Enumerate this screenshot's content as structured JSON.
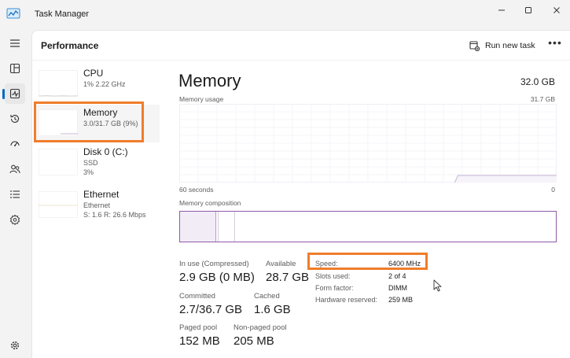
{
  "window": {
    "title": "Task Manager",
    "controls": {
      "minimize": "minimize-icon",
      "maximize": "maximize-icon",
      "close": "close-icon"
    }
  },
  "rail": {
    "items": [
      {
        "id": "menu",
        "icon": "hamburger-icon"
      },
      {
        "id": "processes",
        "icon": "processes-icon"
      },
      {
        "id": "performance",
        "icon": "performance-icon",
        "active": true
      },
      {
        "id": "app-history",
        "icon": "history-icon"
      },
      {
        "id": "startup-apps",
        "icon": "startup-icon"
      },
      {
        "id": "users",
        "icon": "users-icon"
      },
      {
        "id": "details",
        "icon": "details-icon"
      },
      {
        "id": "services",
        "icon": "services-icon"
      }
    ],
    "settings_icon": "gear-icon"
  },
  "header": {
    "title": "Performance",
    "run_task_label": "Run new task",
    "more_label": "•••"
  },
  "resources": [
    {
      "name": "CPU",
      "lines": [
        "1% 2.22 GHz"
      ]
    },
    {
      "name": "Memory",
      "lines": [
        "3.0/31.7 GB (9%)"
      ],
      "selected": true
    },
    {
      "name": "Disk 0 (C:)",
      "lines": [
        "SSD",
        "3%"
      ]
    },
    {
      "name": "Ethernet",
      "lines": [
        "Ethernet",
        "S: 1.6 R: 26.6 Mbps"
      ]
    }
  ],
  "detail": {
    "title": "Memory",
    "total": "32.0 GB",
    "usage_graph": {
      "label": "Memory usage",
      "max_label": "31.7 GB",
      "x_left": "60 seconds",
      "x_right": "0",
      "current_fraction": 0.09
    },
    "composition": {
      "label": "Memory composition",
      "in_use_fraction": 0.095,
      "modified_fraction": 0.005,
      "standby_fraction": 0.045
    },
    "stats": {
      "in_use_label": "In use (Compressed)",
      "in_use_value": "2.9 GB (0 MB)",
      "available_label": "Available",
      "available_value": "28.7 GB",
      "committed_label": "Committed",
      "committed_value": "2.7/36.7 GB",
      "cached_label": "Cached",
      "cached_value": "1.6 GB",
      "paged_pool_label": "Paged pool",
      "paged_pool_value": "152 MB",
      "non_paged_pool_label": "Non-paged pool",
      "non_paged_pool_value": "205 MB"
    },
    "properties": [
      {
        "label": "Speed:",
        "value": "6400 MHz"
      },
      {
        "label": "Slots used:",
        "value": "2 of 4"
      },
      {
        "label": "Form factor:",
        "value": "DIMM"
      },
      {
        "label": "Hardware reserved:",
        "value": "259 MB"
      }
    ]
  },
  "colors": {
    "accent": "#0067c0",
    "highlight": "#f07d2b",
    "memory_purple": "#8e5aa8",
    "memory_fill": "#f2ecf6"
  }
}
